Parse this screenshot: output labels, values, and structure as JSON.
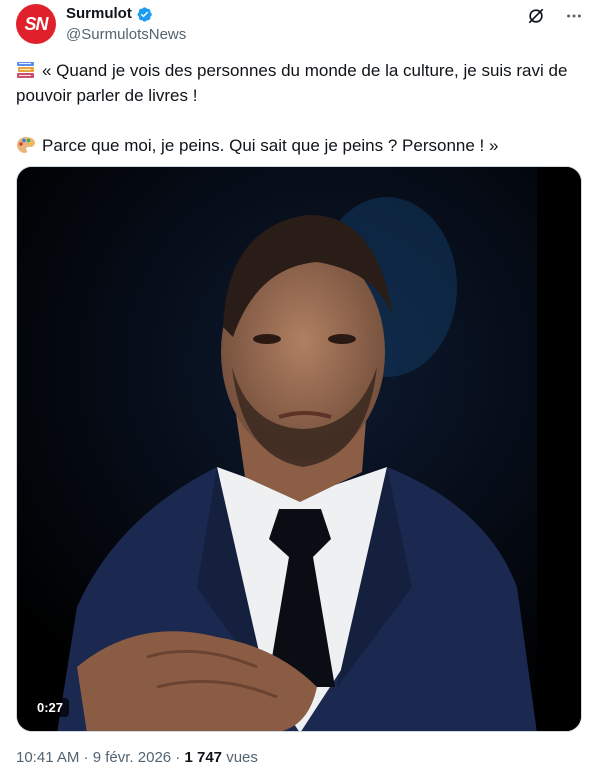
{
  "account": {
    "avatar_text": "SN",
    "name": "Surmulot",
    "handle": "@SurmulotsNews",
    "verified": true,
    "avatar_color": "#e0202a",
    "verified_color": "#1d9bf0"
  },
  "actions": {
    "grok_icon": "grok-icon",
    "more_icon": "more-icon"
  },
  "tweet": {
    "line1_emoji": "books-emoji",
    "line1": "« Quand je vois des personnes du monde de la culture, je suis ravi de pouvoir parler de livres !",
    "line2_emoji": "palette-emoji",
    "line2": "Parce que moi, je peins. Qui sait que je peins ? Personne ! »"
  },
  "media": {
    "duration": "0:27"
  },
  "meta": {
    "time": "10:41 AM",
    "sep1": " · ",
    "date": "9 févr. 2026",
    "sep2": " · ",
    "views_count": "1 747",
    "views_label": " vues"
  }
}
